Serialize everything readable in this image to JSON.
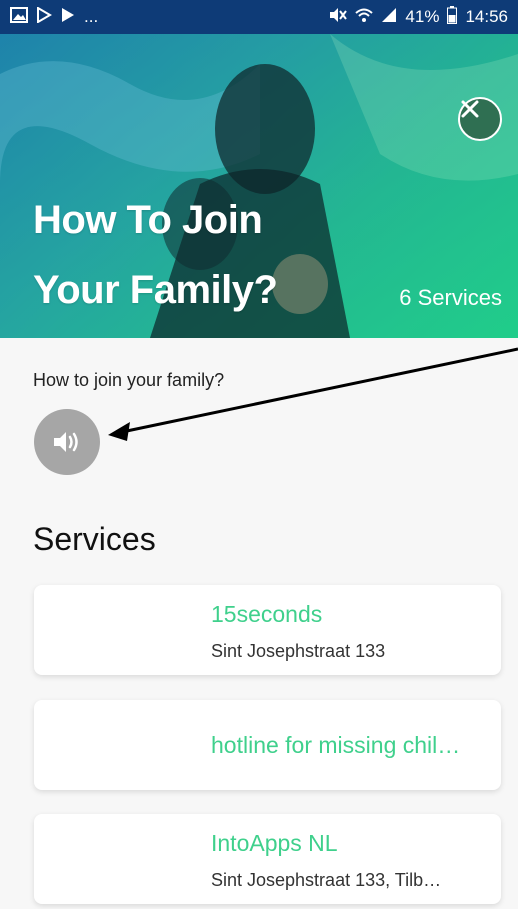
{
  "status_bar": {
    "left_icons": [
      "image-icon",
      "play-store-icon",
      "play-icon"
    ],
    "left_more": "...",
    "battery": "41%",
    "time": "14:56"
  },
  "hero": {
    "title_line1": "How To Join",
    "title_line2": "Your Family?",
    "services_count": "6 Services"
  },
  "audio": {
    "question": "How to join your family?"
  },
  "services": {
    "heading": "Services",
    "items": [
      {
        "name": "15seconds",
        "address": "Sint Josephstraat 133"
      },
      {
        "name": "hotline for missing chil…",
        "address": ""
      },
      {
        "name": "IntoApps NL",
        "address": "Sint Josephstraat 133, Tilb…"
      }
    ]
  },
  "colors": {
    "status_bar": "#0e3b77",
    "accent_green": "#3fd08c",
    "audio_button": "#a6a6a6"
  }
}
